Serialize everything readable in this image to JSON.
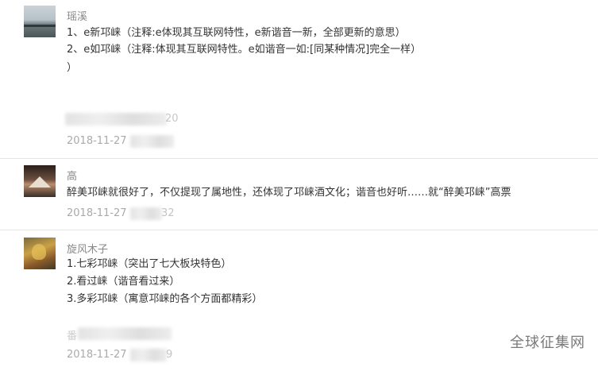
{
  "comments": [
    {
      "username": "瑶溪",
      "lines": [
        "1、e新邛崃（注释:e体现其互联网特性，e新谐音一新，全部更新的意思）",
        "2、e如邛崃（注释:体现其互联网特性。e如谐音一如:[同某种情况]完全一样）",
        "）"
      ],
      "blurred_tail": "20",
      "date": "2018-11-27"
    },
    {
      "username": "高",
      "lines": [
        "醉美邛崃就很好了，不仅提现了属地性，还体现了邛崃酒文化；谐音也好听……就“醉美邛崃”高票"
      ],
      "date": "2018-11-27",
      "blurred_tail": "32"
    },
    {
      "username": "旋风木子",
      "lines": [
        "1.七彩邛崃（突出了七大板块特色）",
        "2.看过崃（谐音看过来）",
        "3.多彩邛崃（寓意邛崃的各个方面都精彩）"
      ],
      "blurred_head": "番",
      "date": "2018-11-27",
      "blurred_tail": "9"
    }
  ],
  "watermark": "全球征集网"
}
